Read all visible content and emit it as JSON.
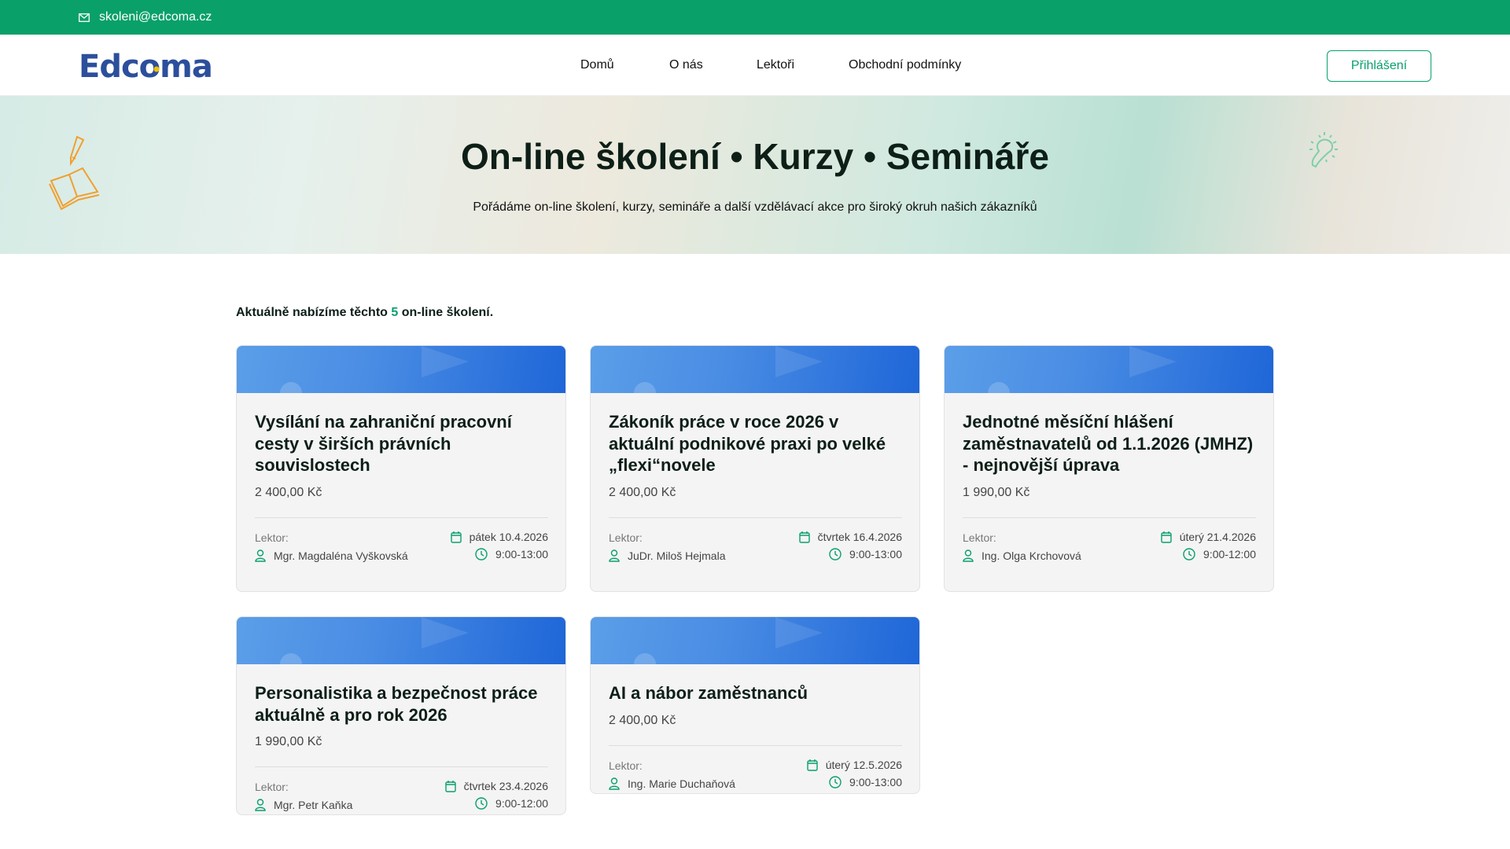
{
  "topbar": {
    "email": "skoleni@edcoma.cz"
  },
  "header": {
    "logo": "Edcoma",
    "nav": [
      "Domů",
      "O nás",
      "Lektoři",
      "Obchodní podmínky"
    ],
    "login": "Přihlášení"
  },
  "hero": {
    "title": "On-line školení • Kurzy • Semináře",
    "subtitle": "Pořádáme on-line školení, kurzy, semináře a další vzdělávací akce pro široký okruh našich zákazníků"
  },
  "intro": {
    "before": "Aktuálně nabízíme těchto",
    "count": "5",
    "after": "on-line školení."
  },
  "lektor_label": "Lektor:",
  "colors": {
    "brand": "#09a06a",
    "card_header": "#1f66d8"
  },
  "courses": [
    {
      "title": "Vysílání na zahraniční pracovní cesty v širších právních souvislostech",
      "price": "2 400,00 Kč",
      "lecturer": "Mgr. Magdaléna Vyškovská",
      "date": "pátek 10.4.2026",
      "time": "9:00-13:00"
    },
    {
      "title": "Zákoník práce v roce 2026 v aktuální podnikové praxi po velké „flexi“novele",
      "price": "2 400,00 Kč",
      "lecturer": "JuDr. Miloš Hejmala",
      "date": "čtvrtek 16.4.2026",
      "time": "9:00-13:00"
    },
    {
      "title": "Jednotné měsíční hlášení zaměstnavatelů od 1.1.2026 (JMHZ) - nejnovější úprava",
      "price": "1 990,00 Kč",
      "lecturer": "Ing. Olga Krchovová",
      "date": "úterý 21.4.2026",
      "time": "9:00-12:00"
    },
    {
      "title": "Personalistika a bezpečnost práce aktuálně a pro rok 2026",
      "price": "1 990,00 Kč",
      "lecturer": "Mgr. Petr Kaňka",
      "date": "čtvrtek 23.4.2026",
      "time": "9:00-12:00"
    },
    {
      "title": "AI a nábor zaměstnanců",
      "price": "2 400,00 Kč",
      "lecturer": "Ing. Marie Duchaňová",
      "date": "úterý 12.5.2026",
      "time": "9:00-13:00"
    }
  ]
}
